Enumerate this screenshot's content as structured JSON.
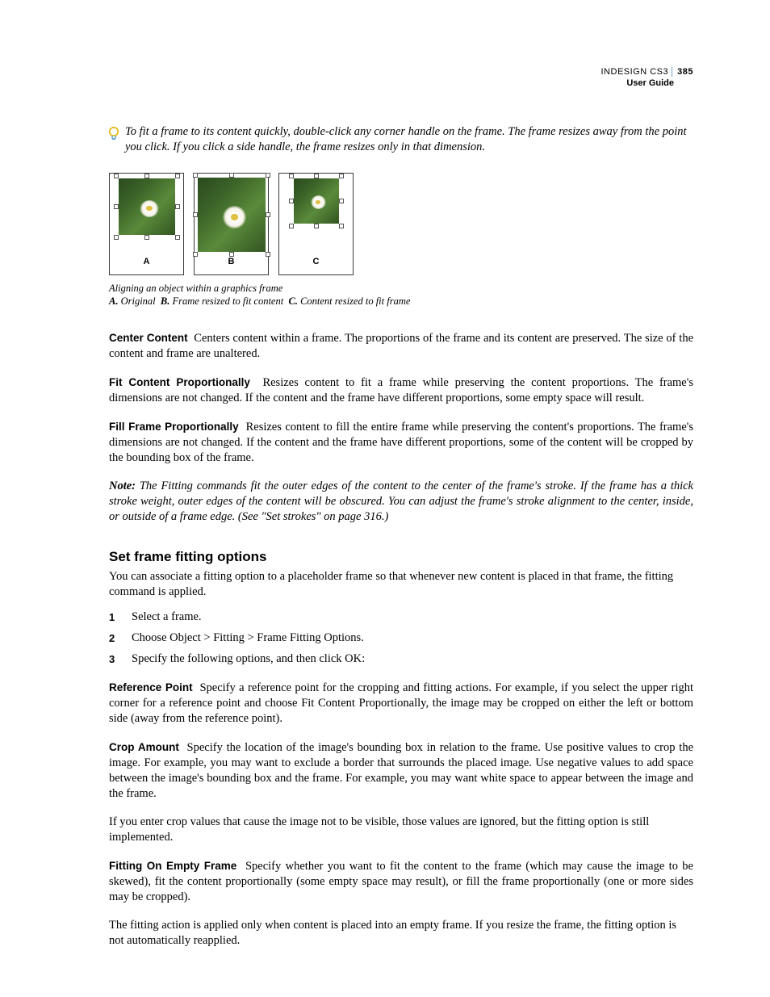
{
  "header": {
    "product": "INDESIGN CS3",
    "doc": "User Guide",
    "page": "385"
  },
  "tip": "To fit a frame to its content quickly, double-click any corner handle on the frame. The frame resizes away from the point you click. If you click a side handle, the frame resizes only in that dimension.",
  "figure": {
    "labels": {
      "a": "A",
      "b": "B",
      "c": "C"
    },
    "caption_title": "Aligning an object within a graphics frame",
    "legend": {
      "a_key": "A.",
      "a_text": "Original",
      "b_key": "B.",
      "b_text": "Frame resized to fit content",
      "c_key": "C.",
      "c_text": "Content resized to fit frame"
    }
  },
  "defs": {
    "center_content": {
      "term": "Center Content",
      "text": "Centers content within a frame. The proportions of the frame and its content are preserved. The size of the content and frame are unaltered."
    },
    "fit_prop": {
      "term": "Fit Content Proportionally",
      "text": "Resizes content to fit a frame while preserving the content proportions. The frame's dimensions are not changed. If the content and the frame have different proportions, some empty space will result."
    },
    "fill_prop": {
      "term": "Fill Frame Proportionally",
      "text": "Resizes content to fill the entire frame while preserving the content's proportions. The frame's dimensions are not changed. If the content and the frame have different proportions, some of the content will be cropped by the bounding box of the frame."
    }
  },
  "note": {
    "label": "Note:",
    "text": "The Fitting commands fit the outer edges of the content to the center of the frame's stroke. If the frame has a thick stroke weight, outer edges of the content will be obscured. You can adjust the frame's stroke alignment to the center, inside, or outside of a frame edge. (See \"Set strokes\" on page 316.)"
  },
  "section": {
    "title": "Set frame fitting options",
    "intro": "You can associate a fitting option to a placeholder frame so that whenever new content is placed in that frame, the fitting command is applied.",
    "steps": [
      "Select a frame.",
      "Choose Object > Fitting > Frame Fitting Options.",
      "Specify the following options, and then click OK:"
    ],
    "ref_point": {
      "term": "Reference Point",
      "text": "Specify a reference point for the cropping and fitting actions. For example, if you select the upper right corner for a reference point and choose Fit Content Proportionally, the image may be cropped on either the left or bottom side (away from the reference point)."
    },
    "crop_amount": {
      "term": "Crop Amount",
      "text": "Specify the location of the image's bounding box in relation to the frame. Use positive values to crop the image. For example, you may want to exclude a border that surrounds the placed image. Use negative values to add space between the image's bounding box and the frame. For example, you may want white space to appear between the image and the frame."
    },
    "crop_followup": "If you enter crop values that cause the image not to be visible, those values are ignored, but the fitting option is still implemented.",
    "fitting_empty": {
      "term": "Fitting On Empty Frame",
      "text": "Specify whether you want to fit the content to the frame (which may cause the image to be skewed), fit the content proportionally (some empty space may result), or fill the frame proportionally (one or more sides may be cropped)."
    },
    "fitting_followup": "The fitting action is applied only when content is placed into an empty frame. If you resize the frame, the fitting option is not automatically reapplied."
  }
}
